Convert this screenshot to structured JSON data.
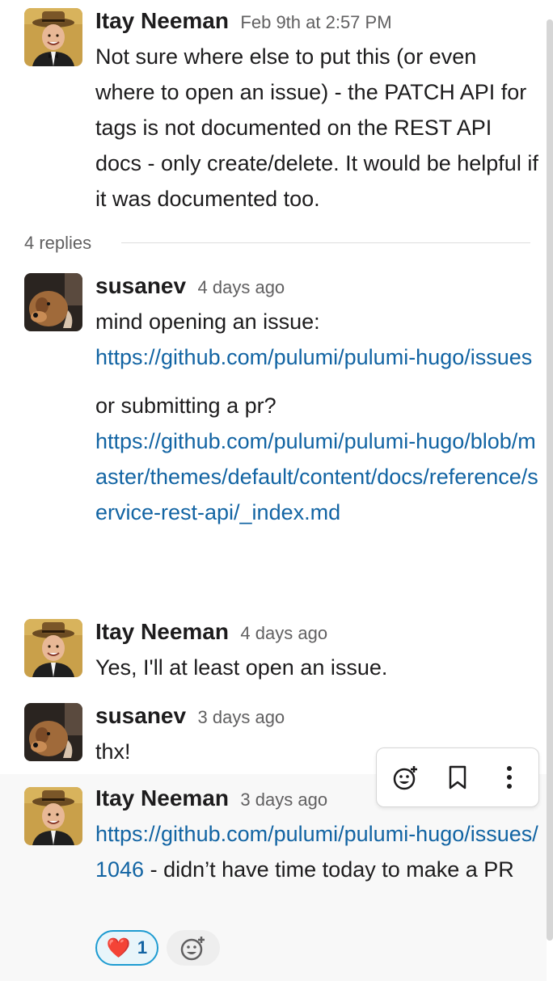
{
  "thread": {
    "parent": {
      "author": "Itay Neeman",
      "time": "Feb 9th at 2:57 PM",
      "text": "Not sure where else to put this (or even where to open an issue) - the PATCH API for tags is not documented on the REST API docs - only create/delete. It would be helpful if it was documented too."
    },
    "replies_label": "4 replies"
  },
  "replies": [
    {
      "author": "susanev",
      "time": "4 days ago",
      "text1": "mind opening an issue:",
      "link1": "https://github.com/pulumi/pulumi-hugo/issues",
      "text2": "or submitting a pr?",
      "link2": "https://github.com/pulumi/pulumi-hugo/blob/master/themes/default/content/docs/reference/service-rest-api/_index.md"
    },
    {
      "author": "Itay Neeman",
      "time": "4 days ago",
      "text": "Yes, I'll at least open an issue."
    },
    {
      "author": "susanev",
      "time": "3 days ago",
      "text": "thx!"
    },
    {
      "author": "Itay Neeman",
      "time": "3 days ago",
      "link": "https://github.com/pulumi/pulumi-hugo/issues/1046",
      "text": " - didn’t have time today to make a PR",
      "reaction": {
        "emoji": "❤️",
        "count": "1"
      }
    }
  ],
  "message_actions": {
    "icons": [
      "add-reaction-icon",
      "bookmark-icon",
      "more-actions-icon"
    ]
  },
  "colors": {
    "link": "#1264a3",
    "reaction_border": "#1d9bd1"
  }
}
